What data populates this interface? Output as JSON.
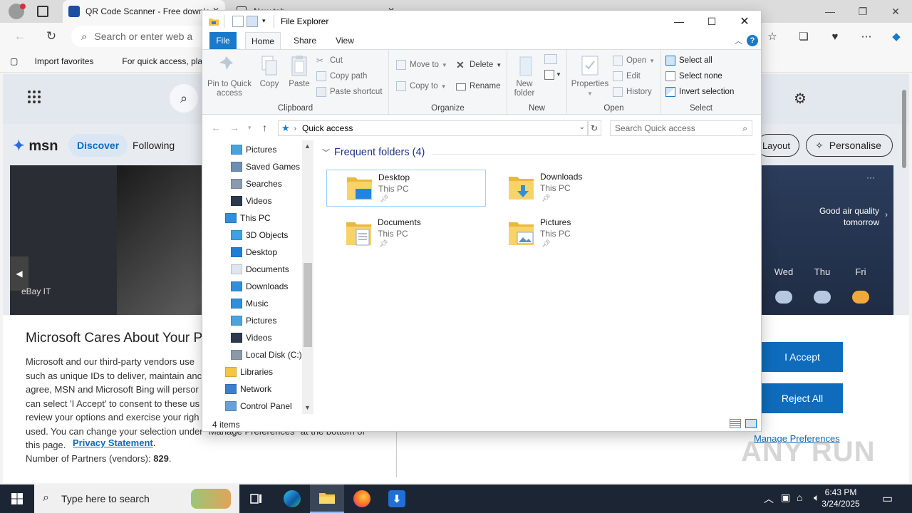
{
  "browser": {
    "tabs": [
      {
        "title": "QR Code Scanner - Free downlo"
      },
      {
        "title": "New tab"
      }
    ],
    "address_placeholder": "Search or enter web a",
    "favorites_bar": [
      "Import favorites",
      "For quick access, place yo"
    ]
  },
  "msn": {
    "brand": "msn",
    "nav": [
      "Discover",
      "Following",
      "Layout",
      "Personalise"
    ],
    "hero_source": "eBay IT",
    "weather": {
      "air_quality": "Good air quality tomorrow",
      "days": [
        "Wed",
        "Thu",
        "Fri"
      ]
    },
    "consent": {
      "title": "Microsoft Cares About Your P",
      "body": "Microsoft and our third-party vendors use\nsuch as unique IDs to deliver, maintain anc\nagree, MSN and Microsoft Bing will persor\ncan select 'I Accept' to consent to these us\nreview your options and exercise your righ\nused.  You can change your selection under  \"Manage Preferences\" at the bottom of\nthis page.",
      "privacy_link": "Privacy Statement",
      "partners_label": "Number of Partners (vendors):",
      "partners_count": "829",
      "accept": "I Accept",
      "reject": "Reject All",
      "manage": "Manage Preferences"
    }
  },
  "explorer": {
    "title": "File Explorer",
    "ribbon_tabs": [
      "File",
      "Home",
      "Share",
      "View"
    ],
    "ribbon": {
      "clipboard": {
        "label": "Clipboard",
        "pin": "Pin to Quick access",
        "copy": "Copy",
        "paste": "Paste",
        "cut": "Cut",
        "copy_path": "Copy path",
        "paste_shortcut": "Paste shortcut"
      },
      "organize": {
        "label": "Organize",
        "move_to": "Move to",
        "copy_to": "Copy to",
        "delete": "Delete",
        "rename": "Rename"
      },
      "new": {
        "label": "New",
        "new_folder": "New folder"
      },
      "open": {
        "label": "Open",
        "properties": "Properties",
        "open": "Open",
        "edit": "Edit",
        "history": "History"
      },
      "select": {
        "label": "Select",
        "select_all": "Select all",
        "select_none": "Select none",
        "invert": "Invert selection"
      }
    },
    "address": "Quick access",
    "search_placeholder": "Search Quick access",
    "nav_items": [
      {
        "label": "Pictures",
        "icon": "pictures-icon",
        "indent": 1
      },
      {
        "label": "Saved Games",
        "icon": "saved-games-icon",
        "indent": 1
      },
      {
        "label": "Searches",
        "icon": "searches-icon",
        "indent": 1
      },
      {
        "label": "Videos",
        "icon": "videos-icon",
        "indent": 1
      },
      {
        "label": "This PC",
        "icon": "this-pc-icon",
        "indent": 0
      },
      {
        "label": "3D Objects",
        "icon": "3d-objects-icon",
        "indent": 1
      },
      {
        "label": "Desktop",
        "icon": "desktop-icon",
        "indent": 1
      },
      {
        "label": "Documents",
        "icon": "documents-icon",
        "indent": 1
      },
      {
        "label": "Downloads",
        "icon": "downloads-icon",
        "indent": 1
      },
      {
        "label": "Music",
        "icon": "music-icon",
        "indent": 1
      },
      {
        "label": "Pictures",
        "icon": "pictures-icon",
        "indent": 1
      },
      {
        "label": "Videos",
        "icon": "videos-icon",
        "indent": 1
      },
      {
        "label": "Local Disk (C:)",
        "icon": "local-disk-icon",
        "indent": 1
      },
      {
        "label": "Libraries",
        "icon": "libraries-icon",
        "indent": 0
      },
      {
        "label": "Network",
        "icon": "network-icon",
        "indent": 0
      },
      {
        "label": "Control Panel",
        "icon": "control-panel-icon",
        "indent": 0
      }
    ],
    "section_title": "Frequent folders (4)",
    "folders": [
      {
        "name": "Desktop",
        "location": "This PC",
        "icon": "desktop-folder-icon"
      },
      {
        "name": "Downloads",
        "location": "This PC",
        "icon": "downloads-folder-icon"
      },
      {
        "name": "Documents",
        "location": "This PC",
        "icon": "documents-folder-icon"
      },
      {
        "name": "Pictures",
        "location": "This PC",
        "icon": "pictures-folder-icon"
      }
    ],
    "status": "4 items"
  },
  "taskbar": {
    "search_placeholder": "Type here to search",
    "time": "6:43 PM",
    "date": "3/24/2025"
  },
  "watermark": "ANY RUN",
  "colors": {
    "accent": "#1979ca",
    "edge_blue": "#0f6cbd",
    "taskbar": "#1c2534",
    "section_title": "#1e3287"
  }
}
